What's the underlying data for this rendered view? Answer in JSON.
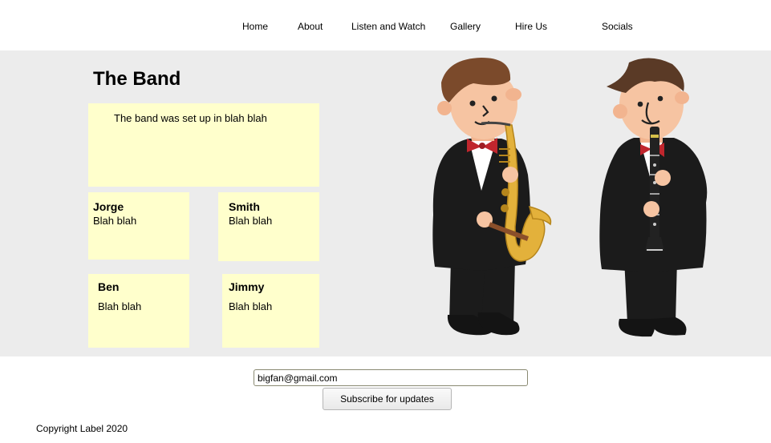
{
  "nav": {
    "items": [
      "Home",
      "About",
      "Listen and Watch",
      "Gallery",
      "Hire Us",
      "Socials"
    ]
  },
  "band": {
    "title": "The Band",
    "intro": "The band was set up in blah blah",
    "members": [
      {
        "name": "Jorge",
        "bio": "Blah blah"
      },
      {
        "name": "Smith",
        "bio": "Blah blah"
      },
      {
        "name": "Ben",
        "bio": "Blah blah"
      },
      {
        "name": "Jimmy",
        "bio": "Blah blah"
      }
    ]
  },
  "illustration": {
    "icons": [
      "saxophone-player-illustration",
      "clarinet-player-illustration"
    ]
  },
  "subscribe": {
    "email_value": "bigfan@gmail.com",
    "button_label": "Subscribe for updates"
  },
  "footer": {
    "copyright": "Copyright Label 2020"
  },
  "colors": {
    "hero_background": "#ececec",
    "card_background": "#ffffcc",
    "page_background": "#ffffff"
  }
}
